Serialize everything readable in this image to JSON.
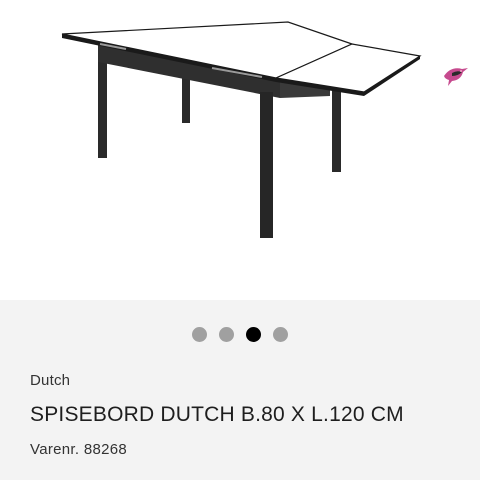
{
  "product": {
    "brand": "Dutch",
    "title": "SPISEBORD DUTCH B.80 X L.120 CM",
    "sku_label": "Varenr.",
    "sku_value": "88268",
    "image_icon": "extendable-dining-table-photo"
  },
  "carousel": {
    "dot_count": 4,
    "active_index": 2,
    "colors": {
      "inactive": "#a0a0a0",
      "active": "#000000"
    }
  },
  "brand_logo": {
    "icon": "bird-logo-icon",
    "colors": [
      "#c64a8e",
      "#2a2a2a",
      "#f0a4c8"
    ]
  }
}
